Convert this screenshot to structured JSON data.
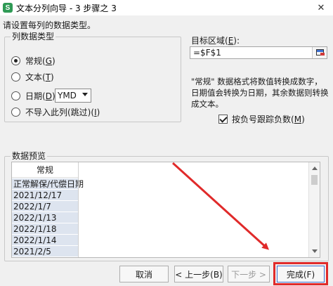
{
  "window": {
    "title": "文本分列向导 - 3 步骤之 3",
    "app_icon_letter": "S",
    "close_glyph": "✕"
  },
  "instruction": "请设置每列的数据类型。",
  "column_type_group": {
    "legend": "列数据类型",
    "options": [
      {
        "label": "常规",
        "key": "G",
        "selected": true
      },
      {
        "label": "文本",
        "key": "T",
        "selected": false
      },
      {
        "label": "日期",
        "key": "D",
        "selected": false
      },
      {
        "label": "不导入此列(跳过)",
        "key": "I",
        "selected": false
      }
    ],
    "date_format": "YMD"
  },
  "target": {
    "label": "目标区域",
    "label_key": "E",
    "label_suffix": ":",
    "value": "=$F$1"
  },
  "description": "\"常规\" 数据格式将数值转换成数字，日期值会转换为日期，其余数据则转换成文本。",
  "negative_checkbox": {
    "label": "按负号跟踪负数",
    "key": "M",
    "checked": true
  },
  "preview": {
    "legend": "数据预览",
    "header": "常规",
    "rows": [
      "正常解保/代偿日期",
      "2021/12/17",
      "2022/1/7",
      "2022/1/13",
      "2022/1/18",
      "2022/1/14",
      "2021/2/5"
    ]
  },
  "buttons": {
    "cancel": "取消",
    "back": "< 上一步(B)",
    "next": "下一步 >",
    "finish": "完成(F)"
  },
  "colors": {
    "annotation_red": "#e02a2a",
    "preview_cell_bg": "#dde4ef",
    "app_icon_green": "#2f9a55"
  }
}
